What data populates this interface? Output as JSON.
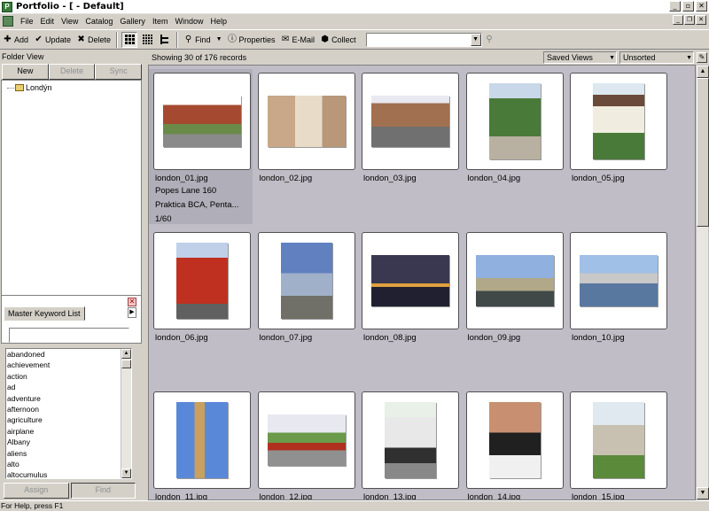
{
  "window": {
    "title": "Portfolio - [ - Default]"
  },
  "menu": [
    "File",
    "Edit",
    "View",
    "Catalog",
    "Gallery",
    "Item",
    "Window",
    "Help"
  ],
  "toolbar": {
    "add": "Add",
    "update": "Update",
    "delete": "Delete",
    "find": "Find",
    "properties": "Properties",
    "email": "E-Mail",
    "collect": "Collect"
  },
  "folder_view": {
    "title": "Folder View",
    "buttons": {
      "new": "New",
      "delete": "Delete",
      "sync": "Sync"
    },
    "root": "Londýn"
  },
  "keywords": {
    "tab": "Master Keyword List",
    "items": [
      "abandoned",
      "achievement",
      "action",
      "ad",
      "adventure",
      "afternoon",
      "agriculture",
      "airplane",
      "Albany",
      "aliens",
      "alto",
      "altocumulus"
    ],
    "assign": "Assign",
    "find": "Find"
  },
  "main": {
    "count": "Showing 30 of 176 records",
    "saved_views": "Saved Views",
    "sort": "Unsorted"
  },
  "thumbnails": [
    {
      "name": "london_01.jpg",
      "orientation": "landscape",
      "scene": "house",
      "selected": true,
      "meta": [
        "Popes Lane 160",
        "Praktica BCA, Penta...",
        "1/60"
      ]
    },
    {
      "name": "london_02.jpg",
      "orientation": "landscape",
      "scene": "room"
    },
    {
      "name": "london_03.jpg",
      "orientation": "landscape",
      "scene": "street"
    },
    {
      "name": "london_04.jpg",
      "orientation": "portrait",
      "scene": "garden"
    },
    {
      "name": "london_05.jpg",
      "orientation": "portrait",
      "scene": "tudor"
    },
    {
      "name": "london_06.jpg",
      "orientation": "portrait",
      "scene": "bus"
    },
    {
      "name": "london_07.jpg",
      "orientation": "portrait",
      "scene": "eye"
    },
    {
      "name": "london_08.jpg",
      "orientation": "landscape",
      "scene": "night"
    },
    {
      "name": "london_09.jpg",
      "orientation": "landscape",
      "scene": "parliament"
    },
    {
      "name": "london_10.jpg",
      "orientation": "landscape",
      "scene": "river"
    },
    {
      "name": "london_11.jpg",
      "orientation": "portrait",
      "scene": "bigben"
    },
    {
      "name": "london_12.jpg",
      "orientation": "landscape",
      "scene": "roadbus"
    },
    {
      "name": "london_13.jpg",
      "orientation": "portrait",
      "scene": "van"
    },
    {
      "name": "london_14.jpg",
      "orientation": "portrait",
      "scene": "police"
    },
    {
      "name": "london_15.jpg",
      "orientation": "portrait",
      "scene": "stpauls"
    }
  ],
  "status": "For Help, press F1"
}
